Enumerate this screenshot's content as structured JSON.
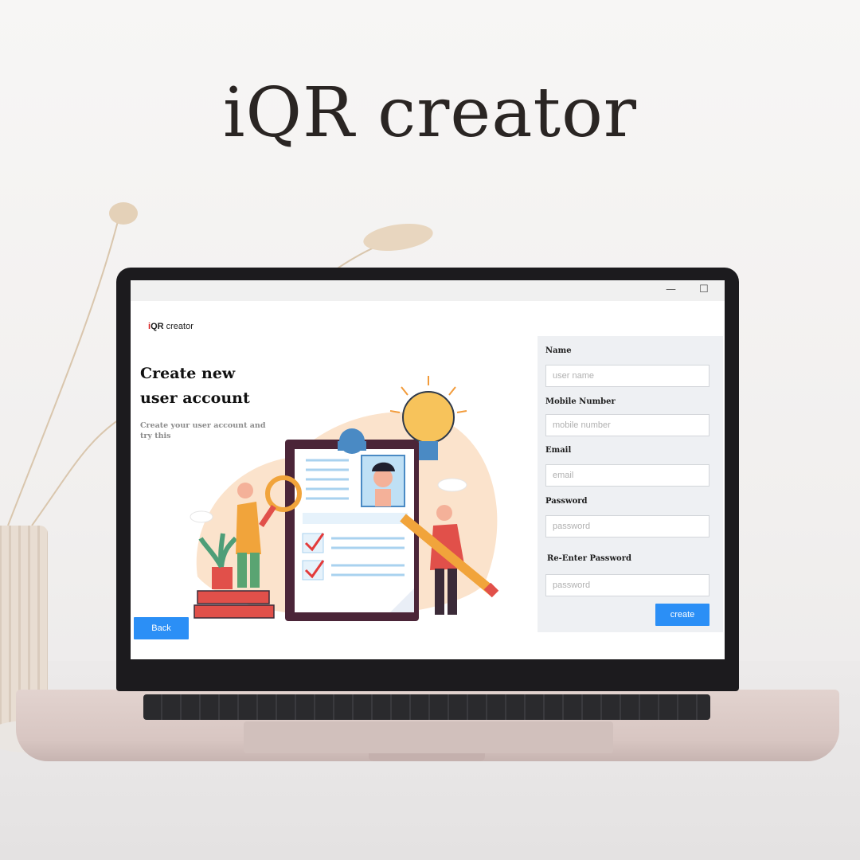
{
  "headline": "iQR creator",
  "window": {
    "minimize_glyph": "—",
    "maximize_glyph": "☐"
  },
  "app": {
    "logo_i": "i",
    "logo_qr": "QR",
    "logo_rest": " creator"
  },
  "page": {
    "title_line1": "Create new",
    "title_line2": "user account",
    "subtitle": "Create your user account and try this"
  },
  "form": {
    "fields": [
      {
        "label": "Name",
        "placeholder": "user name"
      },
      {
        "label": "Mobile Number",
        "placeholder": "mobile number"
      },
      {
        "label": "Email",
        "placeholder": "email"
      },
      {
        "label": "Password",
        "placeholder": "password"
      },
      {
        "label": "Re-Enter Password",
        "placeholder": "password"
      }
    ],
    "create_label": "create"
  },
  "buttons": {
    "back_label": "Back"
  },
  "colors": {
    "accent": "#2b8ff6",
    "logo_red": "#d81e1e",
    "panel_bg": "#eef0f3"
  }
}
